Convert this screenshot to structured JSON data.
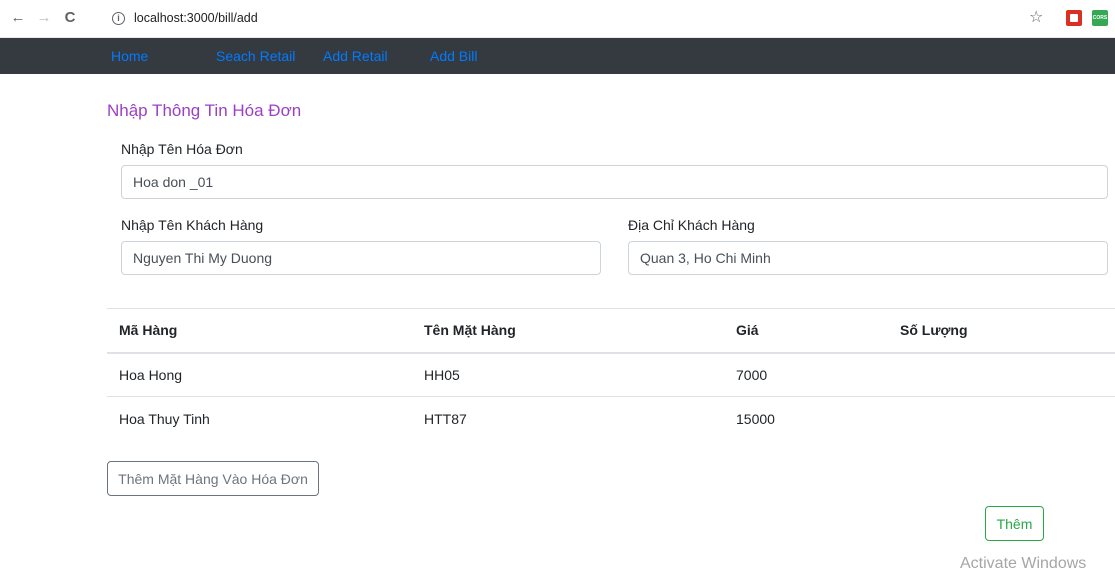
{
  "browser": {
    "url": "localhost:3000/bill/add",
    "back_glyph": "←",
    "forward_glyph": "→",
    "reload_glyph": "C",
    "info_glyph": "i",
    "star_glyph": "☆",
    "ext_cors_label": "CORS"
  },
  "navbar": {
    "items": [
      {
        "label": "Home"
      },
      {
        "label": "Seach Retail"
      },
      {
        "label": "Add Retail"
      },
      {
        "label": "Add Bill"
      }
    ]
  },
  "form": {
    "heading": "Nhập Thông Tin Hóa Đơn",
    "bill_name_label": "Nhập Tên Hóa Đơn",
    "bill_name_value": "Hoa don _01",
    "customer_name_label": "Nhập Tên Khách Hàng",
    "customer_name_value": "Nguyen Thi My Duong",
    "customer_address_label": "Địa Chỉ Khách Hàng",
    "customer_address_value": "Quan 3, Ho Chi Minh"
  },
  "table": {
    "headers": [
      "Mã Hàng",
      "Tên Mặt Hàng",
      "Giá",
      "Số Lượng"
    ],
    "rows": [
      {
        "code": "Hoa Hong",
        "name": "HH05",
        "price": "7000",
        "qty": ""
      },
      {
        "code": "Hoa Thuy Tinh",
        "name": "HTT87",
        "price": "15000",
        "qty": ""
      }
    ]
  },
  "buttons": {
    "add_item": "Thêm Mặt Hàng Vào Hóa Đơn",
    "submit": "Thêm"
  },
  "watermark": "Activate Windows"
}
